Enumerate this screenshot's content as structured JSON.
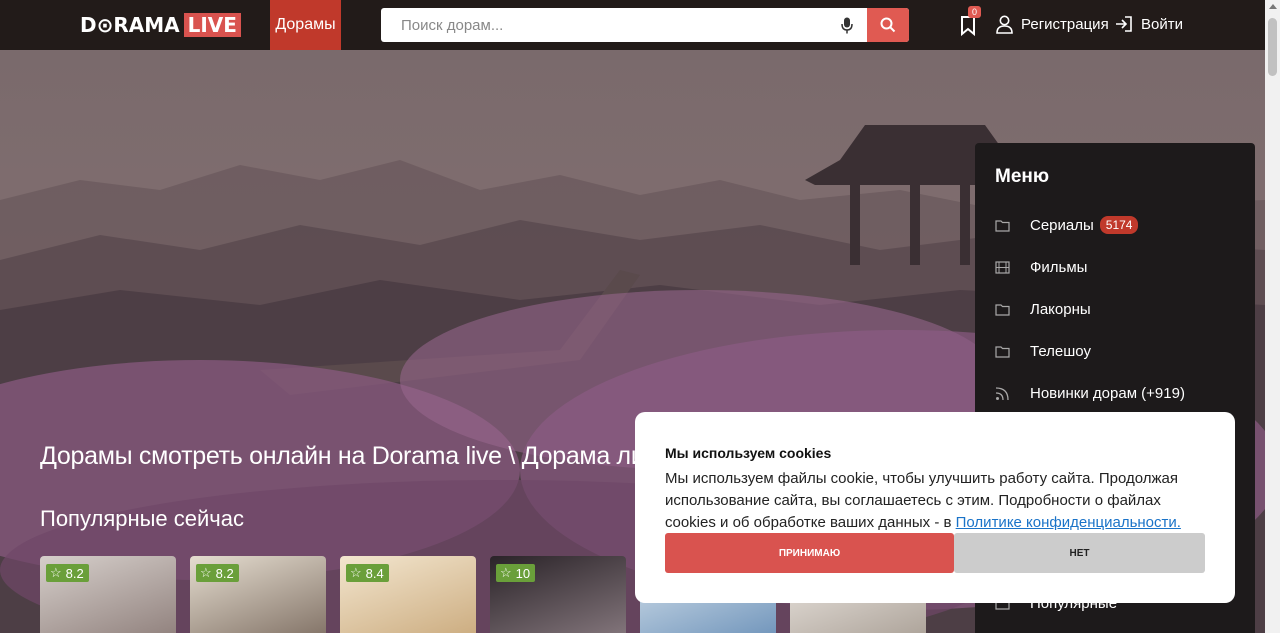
{
  "header": {
    "logo_main": "D⊙RAMA",
    "logo_live": "LIVE",
    "nav_active": "Дорамы",
    "search_placeholder": "Поиск дорам...",
    "bookmarks_count": "0",
    "register_label": "Регистрация",
    "login_label": "Войти"
  },
  "hero": {
    "title": "Дорамы смотреть онлайн на Dorama live \\ Дорама лив",
    "popular_title": "Популярные сейчас",
    "cards": [
      {
        "rating": "8.2",
        "color": "#b9b3b0"
      },
      {
        "rating": "8.2",
        "color": "#cfc6b8"
      },
      {
        "rating": "8.4",
        "color": "#e9dcc4"
      },
      {
        "rating": "10",
        "color": "#3b3339"
      },
      {
        "rating": "",
        "color": "#b6c8d8"
      },
      {
        "rating": "",
        "color": "#d8d2cc"
      }
    ]
  },
  "menu": {
    "title": "Меню",
    "items": [
      {
        "label": "Сериалы",
        "count": "5174",
        "icon": "folder-icon"
      },
      {
        "label": "Фильмы",
        "count": "",
        "icon": "film-icon"
      },
      {
        "label": "Лакорны",
        "count": "",
        "icon": "folder-icon"
      },
      {
        "label": "Телешоу",
        "count": "",
        "icon": "folder-icon"
      },
      {
        "label": "Новинки дорам (+919)",
        "count": "",
        "icon": "rss-icon"
      },
      {
        "label": "Популярные",
        "count": "",
        "icon": "folder-icon"
      }
    ]
  },
  "cookie": {
    "title": "Мы используем cookies",
    "text_before": "Мы используем файлы cookie, чтобы улучшить работу сайта. Продолжая использование сайта, вы соглашаетесь с этим. Подробности о файлах cookies и об обработке ваших данных - в ",
    "link_label": "Политике конфиденциальности.",
    "accept_label": "ПРИНИМАЮ",
    "deny_label": "НЕТ"
  },
  "colors": {
    "accent": "#d9534f",
    "header_bg": "#221b19",
    "rating_bg": "#6a9f3a"
  }
}
